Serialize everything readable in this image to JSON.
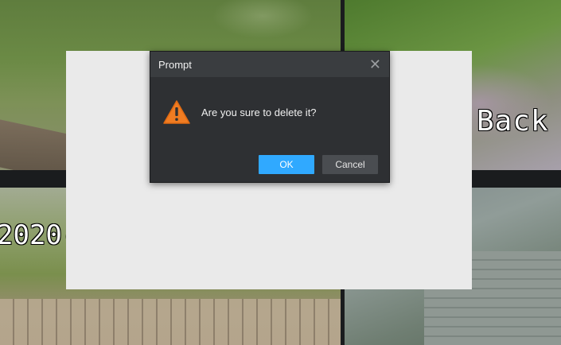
{
  "cameras": [
    {
      "osd": ""
    },
    {
      "osd": "Back"
    },
    {
      "osd": "2020-"
    },
    {
      "osd": ""
    }
  ],
  "dialog": {
    "title": "Prompt",
    "close_glyph": "✕",
    "message": "Are you sure to delete it?",
    "icon": "warning-icon",
    "ok_label": "OK",
    "cancel_label": "Cancel"
  },
  "colors": {
    "accent": "#30a9ff",
    "warning": "#f07c22",
    "dialog_bg": "#2e3033"
  }
}
